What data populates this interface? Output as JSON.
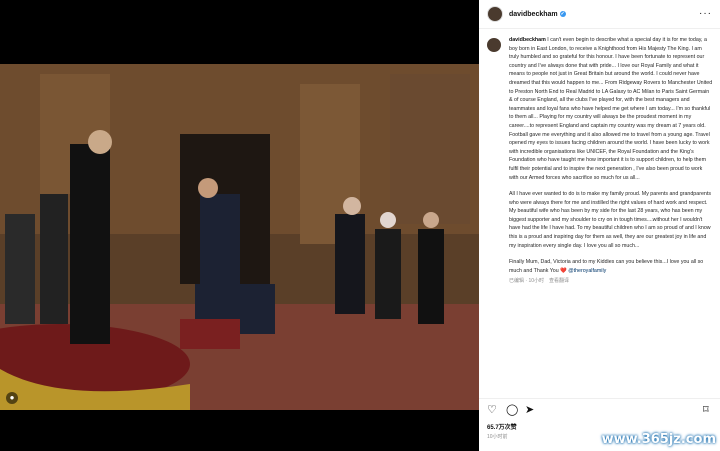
{
  "post": {
    "username": "davidbeckham",
    "verified_mark": "✓",
    "more_icon": "···",
    "caption": {
      "p1": "I can't even begin to describe what a special day it is for me today, a boy born in East London, to receive a Knighthood from His Majesty The King. I am truly humbled and so grateful for this honour. I have been fortunate to represent our country and I've always done that with pride... I love our Royal Family and what it means to people not just in Great Britain but around the world. I could never have dreamed that this would happen to me... From Ridgeway Rovers to Manchester United to Preston North End to Real Madrid to LA Galaxy to AC Milan to Paris Saint Germain & of course England, all the clubs I've played for, with the best managers and teammates and loyal fans who have helped me get where I am today... I'm so thankful to them all... Playing for my country will always be the proudest moment in my career....to represent England and captain my country was my dream at 7 years old. Football gave me everything and it also allowed me to travel from a young age. Travel opened my eyes to issues facing children around the world. I have been lucky to work with incredible organisations like UNICEF, the Royal Foundation and the King's Foundation who have taught me how important it is to support children, to help them fulfil their potential and to inspire the next generation , I've also been proud to work with our Armed forces who sacrifice so much for us all...",
      "p2": "All I have ever wanted to do is to make my family proud. My parents and grandparents who were always there for me and instilled the right values of hard work and respect. My beautiful wife who has been by my side for the last 28 years, who has been my biggest supporter and my shoulder to cry on in tough times....without her I wouldn't have had the life I have had. To my beautiful children who I am so proud of and I know this is a proud and inspiring day for them as well, they are our greatest joy in life and my inspiration every single day. I love you all so much...",
      "p3": "Finally Mum, Dad, Victoria and to my Kiddies can you believe this...I love you all so much and Thank You ❤️",
      "mention": "@theroyalfamily",
      "meta": "已编辑 · 10小时　查看翻译"
    },
    "actions": {
      "like_icon": "♡",
      "comment_icon": "◯",
      "share_icon": "➤",
      "save_icon": "⌑"
    },
    "likes": "65.7万次赞",
    "time": "10小时前"
  },
  "watermark": "www.365jz.com",
  "photo_badge": "●"
}
